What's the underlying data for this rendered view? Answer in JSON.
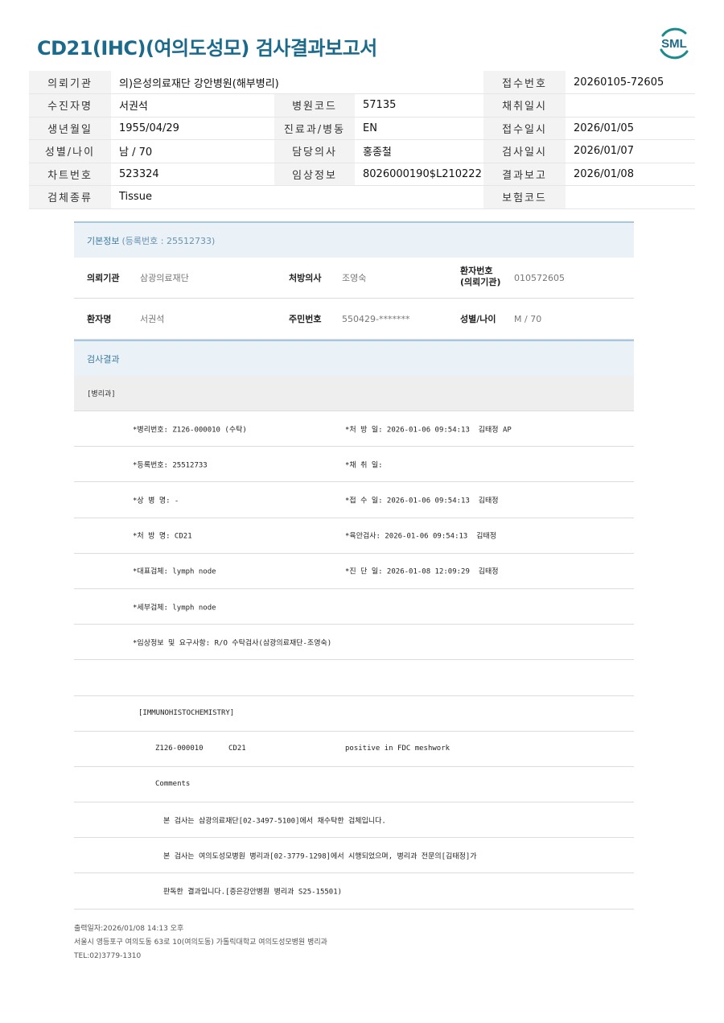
{
  "title": "CD21(IHC)(여의도성모) 검사결과보고서",
  "logo_text": "SML",
  "header": {
    "rows": [
      [
        "의뢰기관",
        "의)은성의료재단 강안병원(해부병리)",
        "",
        "",
        "접수번호",
        "20260105-72605"
      ],
      [
        "수진자명",
        "서권석",
        "병원코드",
        "57135",
        "채취일시",
        ""
      ],
      [
        "생년월일",
        "1955/04/29",
        "진료과/병동",
        "EN",
        "접수일시",
        "2026/01/05"
      ],
      [
        "성별/나이",
        "남 / 70",
        "담당의사",
        "홍종철",
        "검사일시",
        "2026/01/07"
      ],
      [
        "차트번호",
        "523324",
        "임상정보",
        "8026000190$L210222",
        "결과보고",
        "2026/01/08"
      ],
      [
        "검체종류",
        "Tissue",
        "",
        "",
        "보험코드",
        ""
      ]
    ]
  },
  "basic": {
    "heading": "기본정보",
    "reg_no": "(등록번호 : 25512733)",
    "rows": [
      {
        "k1": "의뢰기관",
        "v1": "삼광의료재단",
        "k2": "처방의사",
        "v2": "조영숙",
        "k3a": "환자번호",
        "k3b": "(의뢰기관)",
        "v3": "010572605"
      },
      {
        "k1": "환자명",
        "v1": "서권석",
        "k2": "주민번호",
        "v2": "550429-*******",
        "k3a": "성별/나이",
        "k3b": "",
        "v3": "M / 70"
      }
    ]
  },
  "results": {
    "heading": "검사결과",
    "dept": "[병리과]",
    "lines": [
      [
        "*병리번호: Z126-000010 (수탁)",
        "*처 방 일: 2026-01-06 09:54:13  김태정 AP"
      ],
      [
        "*등록번호: 25512733",
        "*채 취 일:"
      ],
      [
        "*상 병 명: -",
        "*접 수 일: 2026-01-06 09:54:13  김태정"
      ],
      [
        "*처 방 명: CD21",
        "*육안검사: 2026-01-06 09:54:13  김태정"
      ],
      [
        "*대표검체: lymph node",
        "*진 단 일: 2026-01-08 12:09:29  김태정"
      ],
      [
        "*세부검체: lymph node",
        ""
      ],
      [
        "*임상정보 및 요구사항: R/O 수탁검사(삼광의료재단-조영숙)",
        ""
      ]
    ],
    "ihc_heading": "[IMMUNOHISTOCHEMISTRY]",
    "ihc_row": {
      "no": "Z126-000010",
      "marker": "CD21",
      "result": "positive in FDC meshwork"
    },
    "comments_label": "Comments",
    "comments": [
      "본 검사는 삼광의료재단[02-3497-5100]에서 채수탁한 검체입니다.",
      "본 검사는 여의도성모병원 병리과[02-3779-1298]에서 시행되었으며, 병리과 전문의[김태정]가",
      "판독한 결과입니다.[증은강안병원 병리과 S25-15501)"
    ]
  },
  "footer": {
    "printed": "출력일자:2026/01/08 14:13 오후",
    "address": "서울시 영등포구 여의도동 63로 10(여의도동) 가톨릭대학교 여의도성모병원 병리과",
    "tel": "TEL:02)3779-1310"
  },
  "colors": {
    "title": "#1b6a8c",
    "section_bg": "#eaf1f7",
    "section_text": "#3a7ba3"
  }
}
